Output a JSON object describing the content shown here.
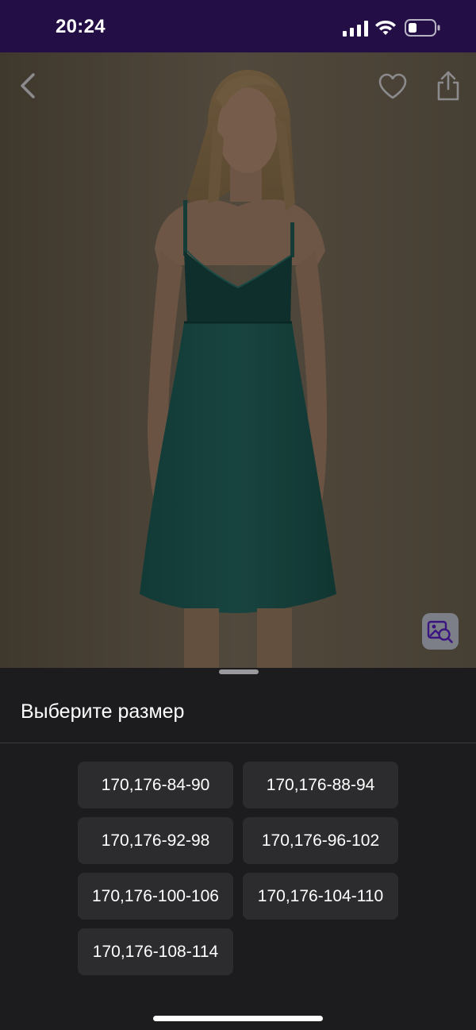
{
  "status_bar": {
    "time": "20:24",
    "icons": [
      "cellular-signal-icon",
      "wifi-icon",
      "battery-icon"
    ]
  },
  "product": {
    "nav_icons": [
      "back-icon",
      "favorite-heart-icon",
      "share-icon"
    ],
    "visual_search_icon": "image-search-icon"
  },
  "size_sheet": {
    "title": "Выберите размер",
    "sizes": [
      "170,176-84-90",
      "170,176-88-94",
      "170,176-92-98",
      "170,176-96-102",
      "170,176-100-106",
      "170,176-104-110",
      "170,176-108-114"
    ]
  },
  "colors": {
    "status_bar": "#230f45",
    "sheet_background": "#1c1c1e",
    "size_button": "#2c2c2e",
    "accent": "#7b3fe4"
  }
}
